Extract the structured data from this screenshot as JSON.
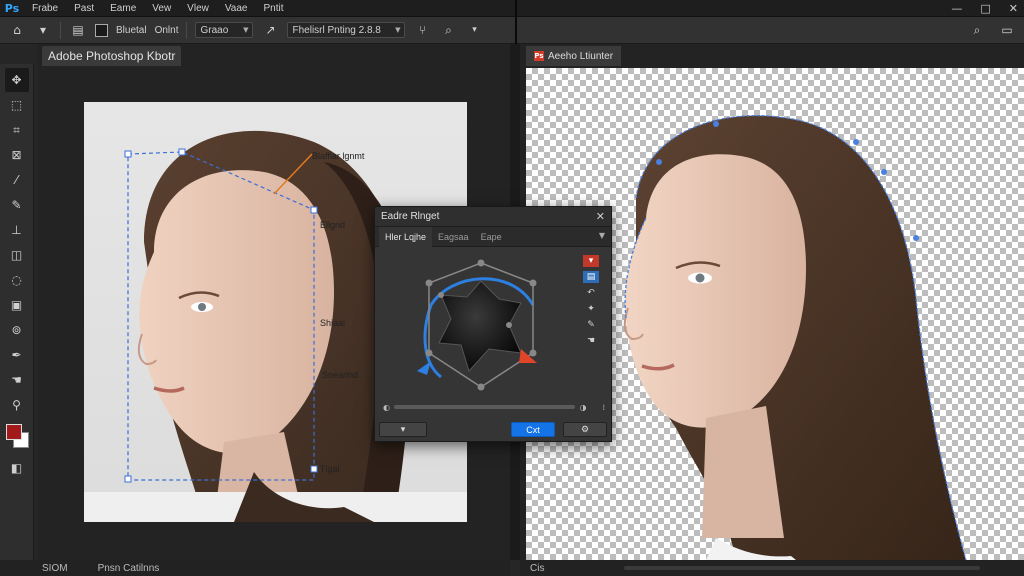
{
  "app": {
    "logo": "Ps"
  },
  "menu": {
    "items": [
      "Frabe",
      "Past",
      "Eame",
      "Vew",
      "Vlew",
      "Vaae",
      "Pntit"
    ]
  },
  "window_controls": {
    "minimize": "—",
    "restore": "□",
    "close": "✕"
  },
  "options_bar": {
    "home_icon": "⌂",
    "blend_label": "Bluetal",
    "mode_label": "Onlnt",
    "sample_select": "Graao",
    "preset_select": "Fhelisrl Pnting 2.8.8",
    "search_icon": "⌕",
    "layout_icon": "▭"
  },
  "toolbar": {
    "tools": [
      "move-tool",
      "marquee-tool",
      "crop-tool",
      "frame-tool",
      "eyedropper-tool",
      "brush-tool",
      "stamp-tool",
      "eraser-tool",
      "lasso-tool",
      "gradient-tool",
      "quick-select-tool",
      "pen-tool",
      "hand-tool"
    ],
    "foreground_color": "#a31a1a",
    "background_color": "#ffffff"
  },
  "left_doc": {
    "tab_title": "Adobe Photoshop Kbotr",
    "annotations": {
      "a1": "Blafflar lgnmt",
      "a2": "Ellgnd",
      "a3": "Shiaal",
      "a4": "Snearlnd",
      "a5": "Tlgal"
    }
  },
  "right_doc": {
    "tab_title": "Aeeho Ltiunter",
    "ps_mark": "Ps"
  },
  "panel": {
    "title": "Eadre Rlnget",
    "close": "✕",
    "tabs": [
      "Hler Lqjhe",
      "Eagsaa",
      "Eape"
    ],
    "active_tab": 0,
    "cancel_label": "",
    "ok_label": "Cxt"
  },
  "status": {
    "left_zoom": "SIOM",
    "left_doc_info": "Pnsn Catilnns",
    "right_info": "Cis"
  }
}
